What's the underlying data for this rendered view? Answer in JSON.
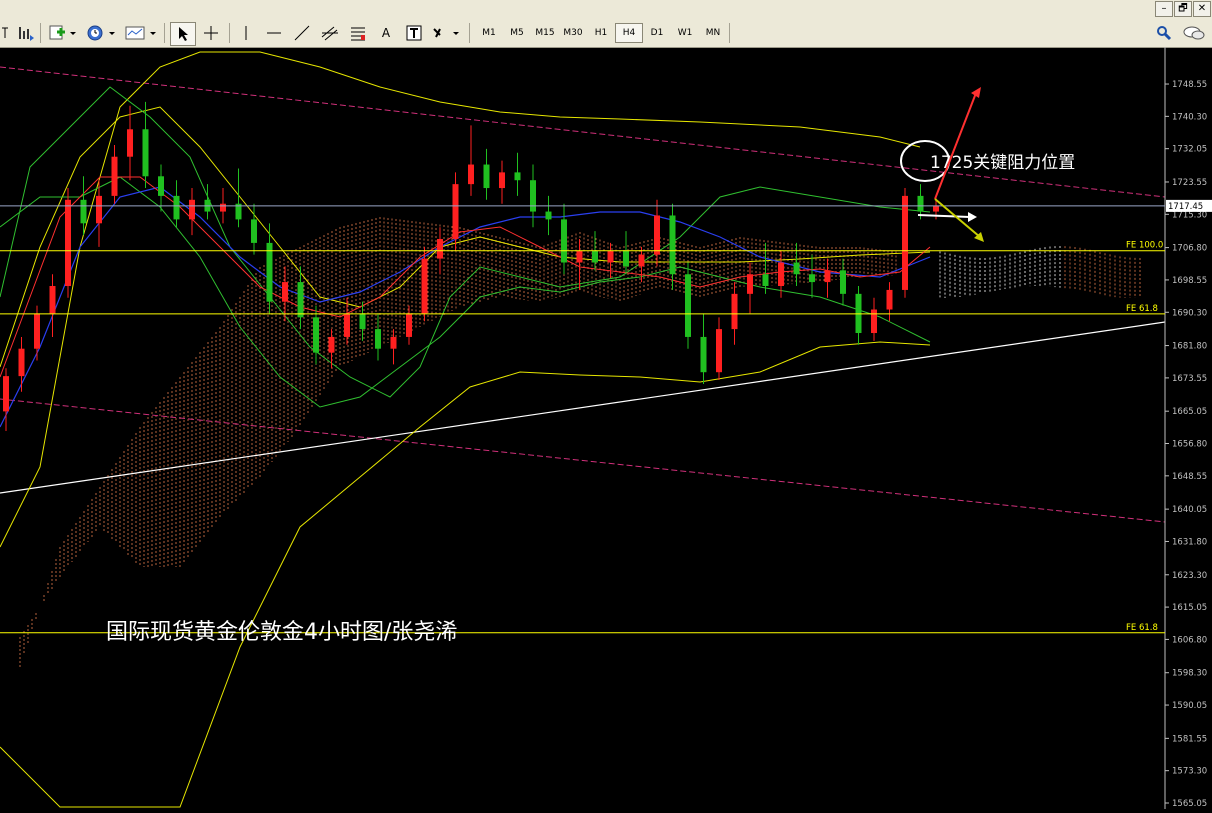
{
  "toolbar": {
    "timeframes": [
      "M1",
      "M5",
      "M15",
      "M30",
      "H1",
      "H4",
      "D1",
      "W1",
      "MN"
    ],
    "active_timeframe": "H4",
    "letter_tool": "A",
    "window_buttons": [
      "–",
      "🗗",
      "✕"
    ]
  },
  "chart_data": {
    "type": "candlestick",
    "title": "",
    "ylim": [
      1565.05,
      1758.0
    ],
    "y_ticks": [
      "1748.55",
      "1740.30",
      "1732.05",
      "1723.55",
      "1715.30",
      "1706.80",
      "1698.55",
      "1690.30",
      "1681.80",
      "1673.55",
      "1665.05",
      "1656.80",
      "1648.55",
      "1640.05",
      "1631.80",
      "1623.30",
      "1615.05",
      "1606.80",
      "1598.30",
      "1590.05",
      "1581.55",
      "1573.30",
      "1565.05"
    ],
    "current_price": "1717.45",
    "levels": [
      {
        "label": "FE 100.0",
        "value": 1706.0,
        "color": "#ffff00"
      },
      {
        "label": "FE 61.8",
        "value": 1689.9,
        "color": "#ffff00"
      },
      {
        "label": "FE 61.8",
        "value": 1608.5,
        "color": "#ffff00"
      }
    ],
    "annotations": {
      "resistance_text": "1725关键阻力位置",
      "chart_caption": "国际现货黄金伦敦金4小时图/张尧浠"
    },
    "candles": [
      {
        "o": 1665,
        "h": 1676,
        "l": 1660,
        "c": 1674
      },
      {
        "o": 1674,
        "h": 1684,
        "l": 1670,
        "c": 1681
      },
      {
        "o": 1681,
        "h": 1692,
        "l": 1678,
        "c": 1690
      },
      {
        "o": 1690,
        "h": 1700,
        "l": 1684,
        "c": 1697
      },
      {
        "o": 1697,
        "h": 1722,
        "l": 1694,
        "c": 1719
      },
      {
        "o": 1719,
        "h": 1725,
        "l": 1710,
        "c": 1713
      },
      {
        "o": 1713,
        "h": 1724,
        "l": 1707,
        "c": 1720
      },
      {
        "o": 1720,
        "h": 1733,
        "l": 1718,
        "c": 1730
      },
      {
        "o": 1730,
        "h": 1743,
        "l": 1724,
        "c": 1737
      },
      {
        "o": 1737,
        "h": 1744,
        "l": 1722,
        "c": 1725
      },
      {
        "o": 1725,
        "h": 1728,
        "l": 1716,
        "c": 1720
      },
      {
        "o": 1720,
        "h": 1724,
        "l": 1712,
        "c": 1714
      },
      {
        "o": 1714,
        "h": 1722,
        "l": 1710,
        "c": 1719
      },
      {
        "o": 1719,
        "h": 1723,
        "l": 1714,
        "c": 1716
      },
      {
        "o": 1716,
        "h": 1722,
        "l": 1713,
        "c": 1718
      },
      {
        "o": 1718,
        "h": 1727,
        "l": 1712,
        "c": 1714
      },
      {
        "o": 1714,
        "h": 1718,
        "l": 1705,
        "c": 1708
      },
      {
        "o": 1708,
        "h": 1713,
        "l": 1690,
        "c": 1693
      },
      {
        "o": 1693,
        "h": 1702,
        "l": 1688,
        "c": 1698
      },
      {
        "o": 1698,
        "h": 1702,
        "l": 1686,
        "c": 1689
      },
      {
        "o": 1689,
        "h": 1692,
        "l": 1677,
        "c": 1680
      },
      {
        "o": 1680,
        "h": 1686,
        "l": 1676,
        "c": 1684
      },
      {
        "o": 1684,
        "h": 1694,
        "l": 1682,
        "c": 1690
      },
      {
        "o": 1690,
        "h": 1693,
        "l": 1683,
        "c": 1686
      },
      {
        "o": 1686,
        "h": 1690,
        "l": 1678,
        "c": 1681
      },
      {
        "o": 1681,
        "h": 1686,
        "l": 1677,
        "c": 1684
      },
      {
        "o": 1684,
        "h": 1692,
        "l": 1682,
        "c": 1690
      },
      {
        "o": 1690,
        "h": 1707,
        "l": 1688,
        "c": 1704
      },
      {
        "o": 1704,
        "h": 1712,
        "l": 1700,
        "c": 1709
      },
      {
        "o": 1709,
        "h": 1726,
        "l": 1706,
        "c": 1723
      },
      {
        "o": 1723,
        "h": 1738,
        "l": 1720,
        "c": 1728
      },
      {
        "o": 1728,
        "h": 1732,
        "l": 1719,
        "c": 1722
      },
      {
        "o": 1722,
        "h": 1729,
        "l": 1718,
        "c": 1726
      },
      {
        "o": 1726,
        "h": 1731,
        "l": 1720,
        "c": 1724
      },
      {
        "o": 1724,
        "h": 1728,
        "l": 1712,
        "c": 1716
      },
      {
        "o": 1716,
        "h": 1720,
        "l": 1710,
        "c": 1714
      },
      {
        "o": 1714,
        "h": 1718,
        "l": 1700,
        "c": 1703
      },
      {
        "o": 1703,
        "h": 1709,
        "l": 1696,
        "c": 1706
      },
      {
        "o": 1706,
        "h": 1711,
        "l": 1701,
        "c": 1703
      },
      {
        "o": 1703,
        "h": 1708,
        "l": 1699,
        "c": 1706
      },
      {
        "o": 1706,
        "h": 1711,
        "l": 1700,
        "c": 1702
      },
      {
        "o": 1702,
        "h": 1707,
        "l": 1698,
        "c": 1705
      },
      {
        "o": 1705,
        "h": 1719,
        "l": 1702,
        "c": 1715
      },
      {
        "o": 1715,
        "h": 1718,
        "l": 1696,
        "c": 1700
      },
      {
        "o": 1700,
        "h": 1703,
        "l": 1681,
        "c": 1684
      },
      {
        "o": 1684,
        "h": 1690,
        "l": 1672,
        "c": 1675
      },
      {
        "o": 1675,
        "h": 1689,
        "l": 1673,
        "c": 1686
      },
      {
        "o": 1686,
        "h": 1698,
        "l": 1682,
        "c": 1695
      },
      {
        "o": 1695,
        "h": 1703,
        "l": 1690,
        "c": 1700
      },
      {
        "o": 1700,
        "h": 1708,
        "l": 1695,
        "c": 1697
      },
      {
        "o": 1697,
        "h": 1706,
        "l": 1694,
        "c": 1703
      },
      {
        "o": 1703,
        "h": 1708,
        "l": 1697,
        "c": 1700
      },
      {
        "o": 1700,
        "h": 1705,
        "l": 1694,
        "c": 1698
      },
      {
        "o": 1698,
        "h": 1704,
        "l": 1694,
        "c": 1701
      },
      {
        "o": 1701,
        "h": 1704,
        "l": 1692,
        "c": 1695
      },
      {
        "o": 1695,
        "h": 1697,
        "l": 1682,
        "c": 1685
      },
      {
        "o": 1685,
        "h": 1694,
        "l": 1683,
        "c": 1691
      },
      {
        "o": 1691,
        "h": 1698,
        "l": 1688,
        "c": 1696
      },
      {
        "o": 1696,
        "h": 1722,
        "l": 1694,
        "c": 1720
      },
      {
        "o": 1720,
        "h": 1723,
        "l": 1714,
        "c": 1716
      },
      {
        "o": 1716,
        "h": 1720,
        "l": 1714,
        "c": 1717.45
      }
    ]
  }
}
